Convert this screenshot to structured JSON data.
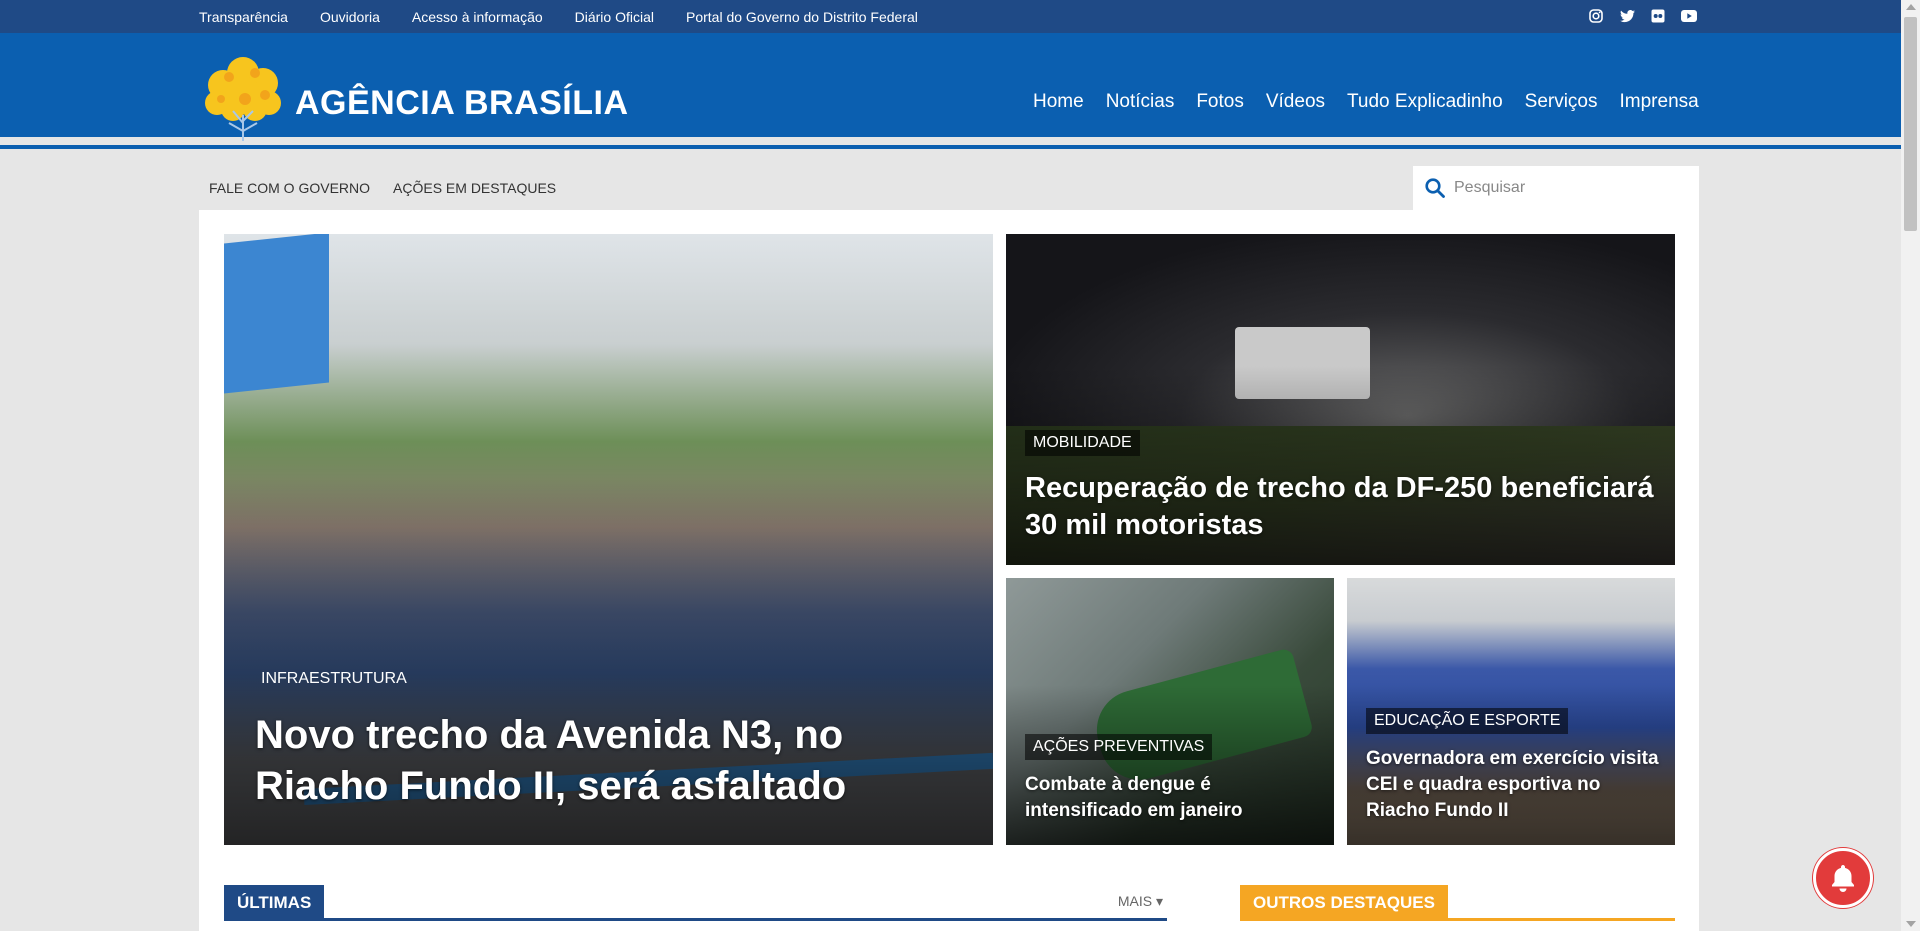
{
  "topbar": {
    "links": [
      "Transparência",
      "Ouvidoria",
      "Acesso à informação",
      "Diário Oficial",
      "Portal do Governo do Distrito Federal"
    ],
    "social_icons": [
      "instagram-icon",
      "twitter-icon",
      "flickr-icon",
      "youtube-icon"
    ]
  },
  "header": {
    "logo_text": "AGÊNCIA BRASÍLIA",
    "nav": [
      "Home",
      "Notícias",
      "Fotos",
      "Vídeos",
      "Tudo Explicadinho",
      "Serviços",
      "Imprensa"
    ]
  },
  "subnav": {
    "items": [
      "FALE COM O GOVERNO",
      "AÇÕES EM DESTAQUES"
    ]
  },
  "search": {
    "placeholder": "Pesquisar"
  },
  "featured": [
    {
      "category": "INFRAESTRUTURA",
      "title": "Novo trecho da Avenida N3, no Riacho Fundo II, será asfaltado"
    },
    {
      "category": "MOBILIDADE",
      "title": "Recuperação de trecho da DF-250 beneficiará 30 mil motoristas"
    },
    {
      "category": "AÇÕES PREVENTIVAS",
      "title": "Combate à dengue é intensificado em janeiro"
    },
    {
      "category": "EDUCAÇÃO E ESPORTE",
      "title": "Governadora em exercício visita CEI e quadra esportiva no Riacho Fundo II"
    }
  ],
  "sections": {
    "latest_label": "ÚLTIMAS",
    "more_label": "MAIS",
    "others_label": "OUTROS DESTAQUES"
  },
  "colors": {
    "topbar": "#1f4a86",
    "header": "#0b5fb0",
    "accent_orange": "#f5a623",
    "bell": "#e23b3b"
  }
}
